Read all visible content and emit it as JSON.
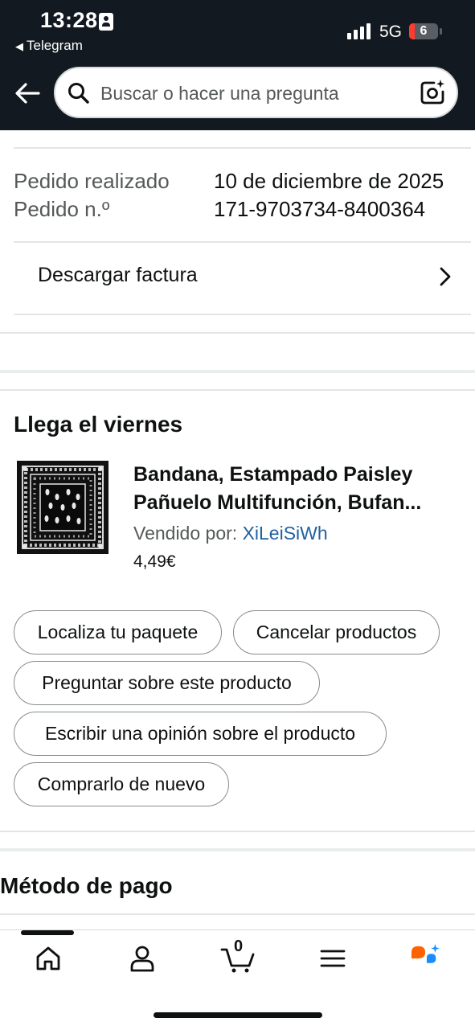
{
  "status_bar": {
    "time": "13:28",
    "back_app": "Telegram",
    "network": "5G",
    "battery": "6"
  },
  "header": {
    "search_placeholder": "Buscar o hacer una pregunta"
  },
  "order": {
    "date_label": "Pedido realizado",
    "date_value": "10 de diciembre de 2025",
    "number_label": "Pedido n.º",
    "number_value": "171-9703734-8400364",
    "invoice_label": "Descargar factura"
  },
  "shipment": {
    "title": "Llega el viernes",
    "product": {
      "title_line1": "Bandana, Estampado Paisley",
      "title_line2": "Pañuelo Multifunción, Bufan...",
      "seller_label": "Vendido por:",
      "seller_name": "XiLeiSiWh",
      "price": "4,49€"
    },
    "actions": [
      "Localiza tu paquete",
      "Cancelar productos",
      "Preguntar sobre este producto",
      "Escribir una opinión sobre el producto",
      "Comprarlo de nuevo"
    ]
  },
  "payment": {
    "title": "Método de pago"
  },
  "bottom_nav": {
    "cart_count": "0",
    "items": [
      "home-icon",
      "account-icon",
      "cart-icon",
      "menu-icon",
      "rufus-icon"
    ]
  },
  "colors": {
    "header_bg": "#131921",
    "link": "#2162a1",
    "accent_orange": "#ff6200",
    "accent_blue": "#1a8cff"
  }
}
